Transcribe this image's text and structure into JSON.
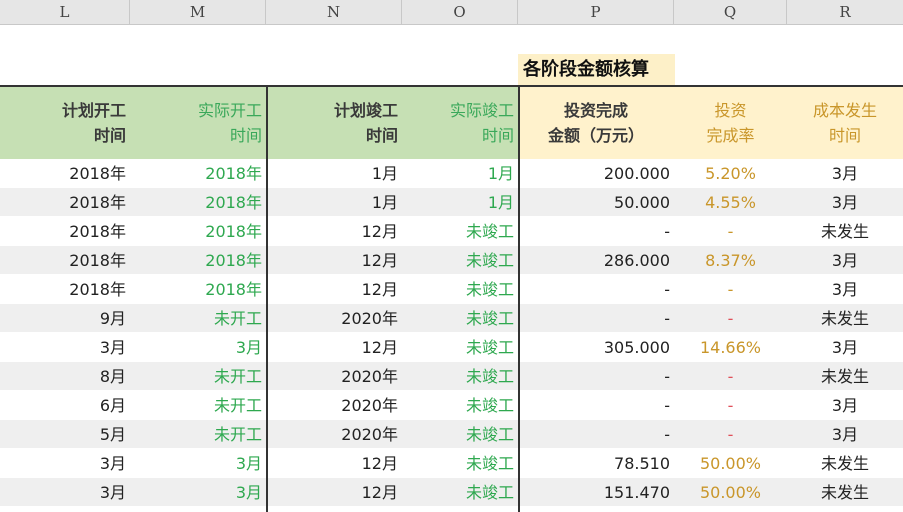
{
  "column_letters": [
    "L",
    "M",
    "N",
    "O",
    "P",
    "Q",
    "R"
  ],
  "section_title": "各阶段金额核算",
  "headers": {
    "L": [
      "计划开工",
      "时间"
    ],
    "M": [
      "实际开工",
      "时间"
    ],
    "N": [
      "计划竣工",
      "时间"
    ],
    "O": [
      "实际竣工",
      "时间"
    ],
    "P": [
      "投资完成",
      "金额（万元）"
    ],
    "Q": [
      "投资",
      "完成率"
    ],
    "R": [
      "成本发生",
      "时间"
    ]
  },
  "rows": [
    {
      "L": "2018年",
      "M": "2018年",
      "N": "1月",
      "O": "1月",
      "P": "200.000",
      "Q": "5.20%",
      "R": "3月"
    },
    {
      "L": "2018年",
      "M": "2018年",
      "N": "1月",
      "O": "1月",
      "P": "50.000",
      "Q": "4.55%",
      "R": "3月"
    },
    {
      "L": "2018年",
      "M": "2018年",
      "N": "12月",
      "O": "未竣工",
      "P": "-",
      "Q": "-",
      "R": "未发生"
    },
    {
      "L": "2018年",
      "M": "2018年",
      "N": "12月",
      "O": "未竣工",
      "P": "286.000",
      "Q": "8.37%",
      "R": "3月"
    },
    {
      "L": "2018年",
      "M": "2018年",
      "N": "12月",
      "O": "未竣工",
      "P": "-",
      "Q": "-",
      "R": "3月"
    },
    {
      "L": "9月",
      "M": "未开工",
      "N": "2020年",
      "O": "未竣工",
      "P": "-",
      "Q": "-",
      "R": "未发生"
    },
    {
      "L": "3月",
      "M": "3月",
      "N": "12月",
      "O": "未竣工",
      "P": "305.000",
      "Q": "14.66%",
      "R": "3月"
    },
    {
      "L": "8月",
      "M": "未开工",
      "N": "2020年",
      "O": "未竣工",
      "P": "-",
      "Q": "-",
      "R": "未发生"
    },
    {
      "L": "6月",
      "M": "未开工",
      "N": "2020年",
      "O": "未竣工",
      "P": "-",
      "Q": "-",
      "R": "3月"
    },
    {
      "L": "5月",
      "M": "未开工",
      "N": "2020年",
      "O": "未竣工",
      "P": "-",
      "Q": "-",
      "R": "3月"
    },
    {
      "L": "3月",
      "M": "3月",
      "N": "12月",
      "O": "未竣工",
      "P": "78.510",
      "Q": "50.00%",
      "R": "未发生"
    },
    {
      "L": "3月",
      "M": "3月",
      "N": "12月",
      "O": "未竣工",
      "P": "151.470",
      "Q": "50.00%",
      "R": "未发生"
    }
  ],
  "colors": {
    "header_green": "#c6e0b4",
    "header_yellow": "#fff2cc",
    "title_fill": "#fdf0c8",
    "green_text": "#2ea84f",
    "gold_text": "#c9962a",
    "red_dash": "#e0505a"
  }
}
